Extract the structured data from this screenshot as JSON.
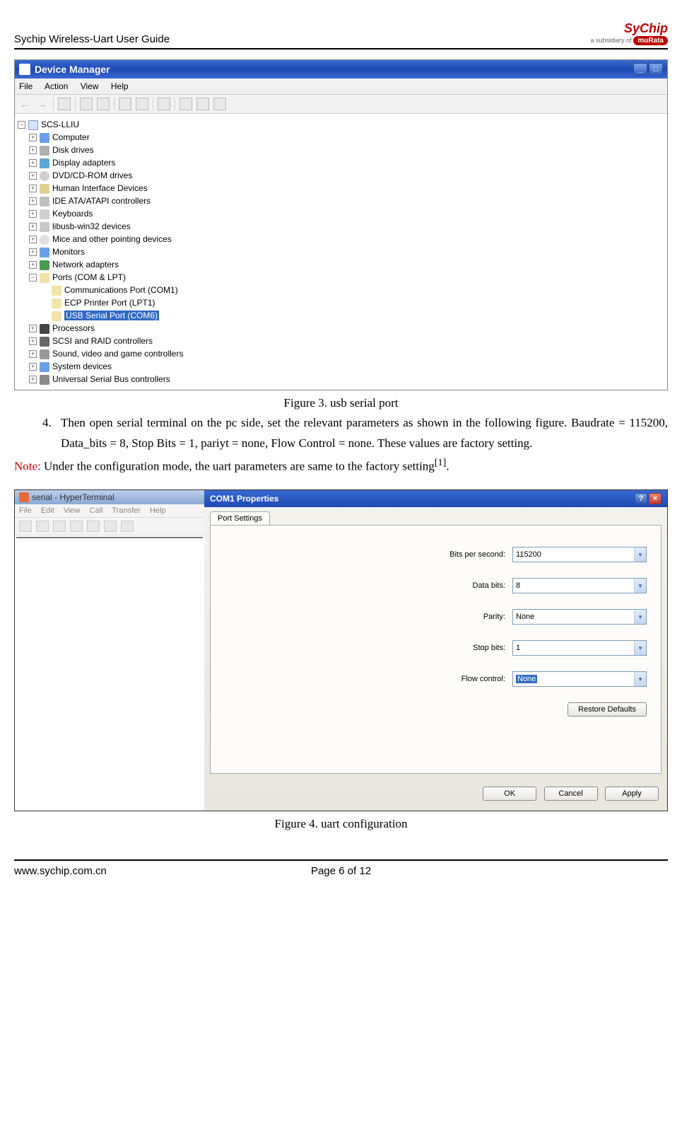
{
  "header": {
    "title": "Sychip Wireless-Uart User Guide",
    "logo_main": "SyChip",
    "logo_sub": "a subsidiary of",
    "logo_brand": "muRata"
  },
  "devmgr": {
    "title": "Device Manager",
    "menu": [
      "File",
      "Action",
      "View",
      "Help"
    ],
    "root": "SCS-LLIU",
    "nodes": [
      {
        "label": "Computer",
        "icon": "i-cmp"
      },
      {
        "label": "Disk drives",
        "icon": "i-dsk"
      },
      {
        "label": "Display adapters",
        "icon": "i-disp"
      },
      {
        "label": "DVD/CD-ROM drives",
        "icon": "i-dvd"
      },
      {
        "label": "Human Interface Devices",
        "icon": "i-hid"
      },
      {
        "label": "IDE ATA/ATAPI controllers",
        "icon": "i-ide"
      },
      {
        "label": "Keyboards",
        "icon": "i-kb"
      },
      {
        "label": "libusb-win32 devices",
        "icon": "i-usb"
      },
      {
        "label": "Mice and other pointing devices",
        "icon": "i-mouse"
      },
      {
        "label": "Monitors",
        "icon": "i-mon"
      },
      {
        "label": "Network adapters",
        "icon": "i-net"
      }
    ],
    "ports_label": "Ports (COM & LPT)",
    "ports": [
      {
        "label": "Communications Port (COM1)",
        "sel": false
      },
      {
        "label": "ECP Printer Port (LPT1)",
        "sel": false
      },
      {
        "label": "USB Serial Port (COM6)",
        "sel": true
      }
    ],
    "tail": [
      {
        "label": "Processors",
        "icon": "i-cpu"
      },
      {
        "label": "SCSI and RAID controllers",
        "icon": "i-scsi"
      },
      {
        "label": "Sound, video and game controllers",
        "icon": "i-snd"
      },
      {
        "label": "System devices",
        "icon": "i-sys"
      },
      {
        "label": "Universal Serial Bus controllers",
        "icon": "i-usbc"
      }
    ]
  },
  "fig3": "Figure 3. usb serial port",
  "step4_num": "4.",
  "step4": "Then open serial terminal on the pc side, set the relevant parameters as shown in the following figure. Baudrate = 115200, Data_bits = 8, Stop Bits = 1, pariyt = none, Flow Control = none. These values are factory setting.",
  "note_label": "Note:",
  "note_text": " Under the configuration mode, the uart parameters are same to the factory setting",
  "note_ref": "[1]",
  "note_dot": ".",
  "ht": {
    "title": "serial - HyperTerminal",
    "menu": [
      "File",
      "Edit",
      "View",
      "Call",
      "Transfer",
      "Help"
    ]
  },
  "props": {
    "title": "COM1 Properties",
    "tab": "Port Settings",
    "rows": [
      {
        "label": "Bits per second:",
        "value": "115200",
        "sel": false
      },
      {
        "label": "Data bits:",
        "value": "8",
        "sel": false
      },
      {
        "label": "Parity:",
        "value": "None",
        "sel": false
      },
      {
        "label": "Stop bits:",
        "value": "1",
        "sel": false
      },
      {
        "label": "Flow control:",
        "value": "None",
        "sel": true
      }
    ],
    "restore": "Restore Defaults",
    "ok": "OK",
    "cancel": "Cancel",
    "apply": "Apply"
  },
  "fig4": "Figure 4. uart configuration",
  "footer": {
    "left": "www.sychip.com.cn",
    "center": "Page 6 of 12"
  }
}
